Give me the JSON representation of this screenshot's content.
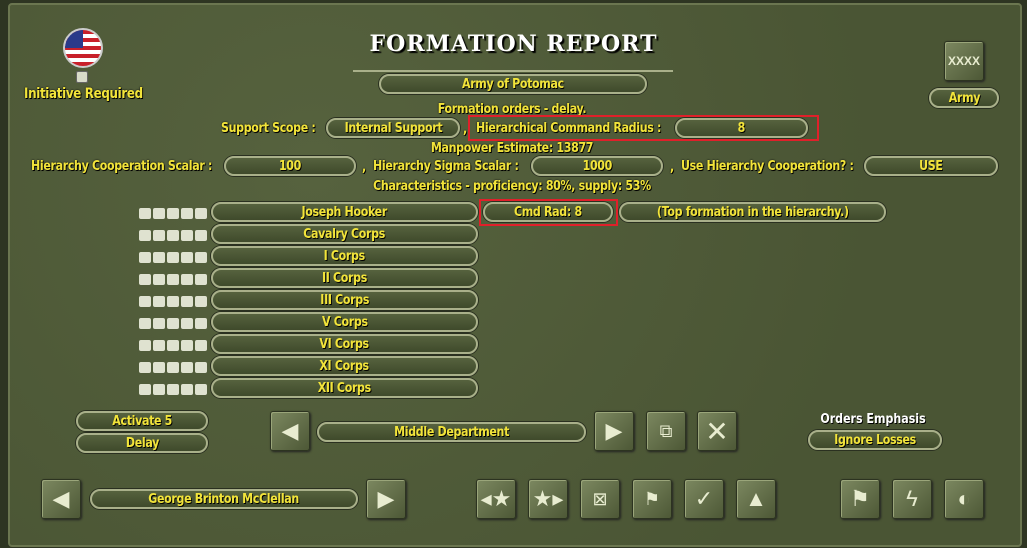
{
  "title": "FORMATION REPORT",
  "formation_name": "Army of Potomac",
  "initiative_label": "Initiative Required",
  "echelon_badge": "XXXX",
  "echelon_label": "Army",
  "orders_text": "Formation orders - delay.",
  "support_scope": {
    "label": "Support Scope :",
    "value": "Internal Support"
  },
  "command_radius": {
    "label": "Hierarchical Command Radius :",
    "value": "8"
  },
  "manpower": "Manpower Estimate: 13877",
  "coop_scalar": {
    "label": "Hierarchy Cooperation Scalar :",
    "value": "100"
  },
  "sigma_scalar": {
    "label": "Hierarchy Sigma Scalar :",
    "value": "1000"
  },
  "use_coop": {
    "label": "Use Hierarchy Cooperation? :",
    "value": "USE"
  },
  "separator": ",",
  "characteristics": "Characteristics - proficiency: 80%, supply: 53%",
  "hierarchy": [
    {
      "name": "Joseph Hooker"
    },
    {
      "name": "Cavalry Corps"
    },
    {
      "name": "I Corps"
    },
    {
      "name": "II Corps"
    },
    {
      "name": "III Corps"
    },
    {
      "name": "V Corps"
    },
    {
      "name": "VI Corps"
    },
    {
      "name": "XI Corps"
    },
    {
      "name": "XII Corps"
    }
  ],
  "cmd_rad": "Cmd Rad: 8",
  "top_formation": "(Top formation in the hierarchy.)",
  "activate": "Activate 5",
  "order": "Delay",
  "department": "Middle Department",
  "orders_emphasis": {
    "label": "Orders Emphasis",
    "value": "Ignore Losses"
  },
  "commander": "George Brinton McClellan",
  "colors": {
    "text": "#f2e43a",
    "panel": "#4e5a38",
    "highlight": "#e0202a"
  }
}
